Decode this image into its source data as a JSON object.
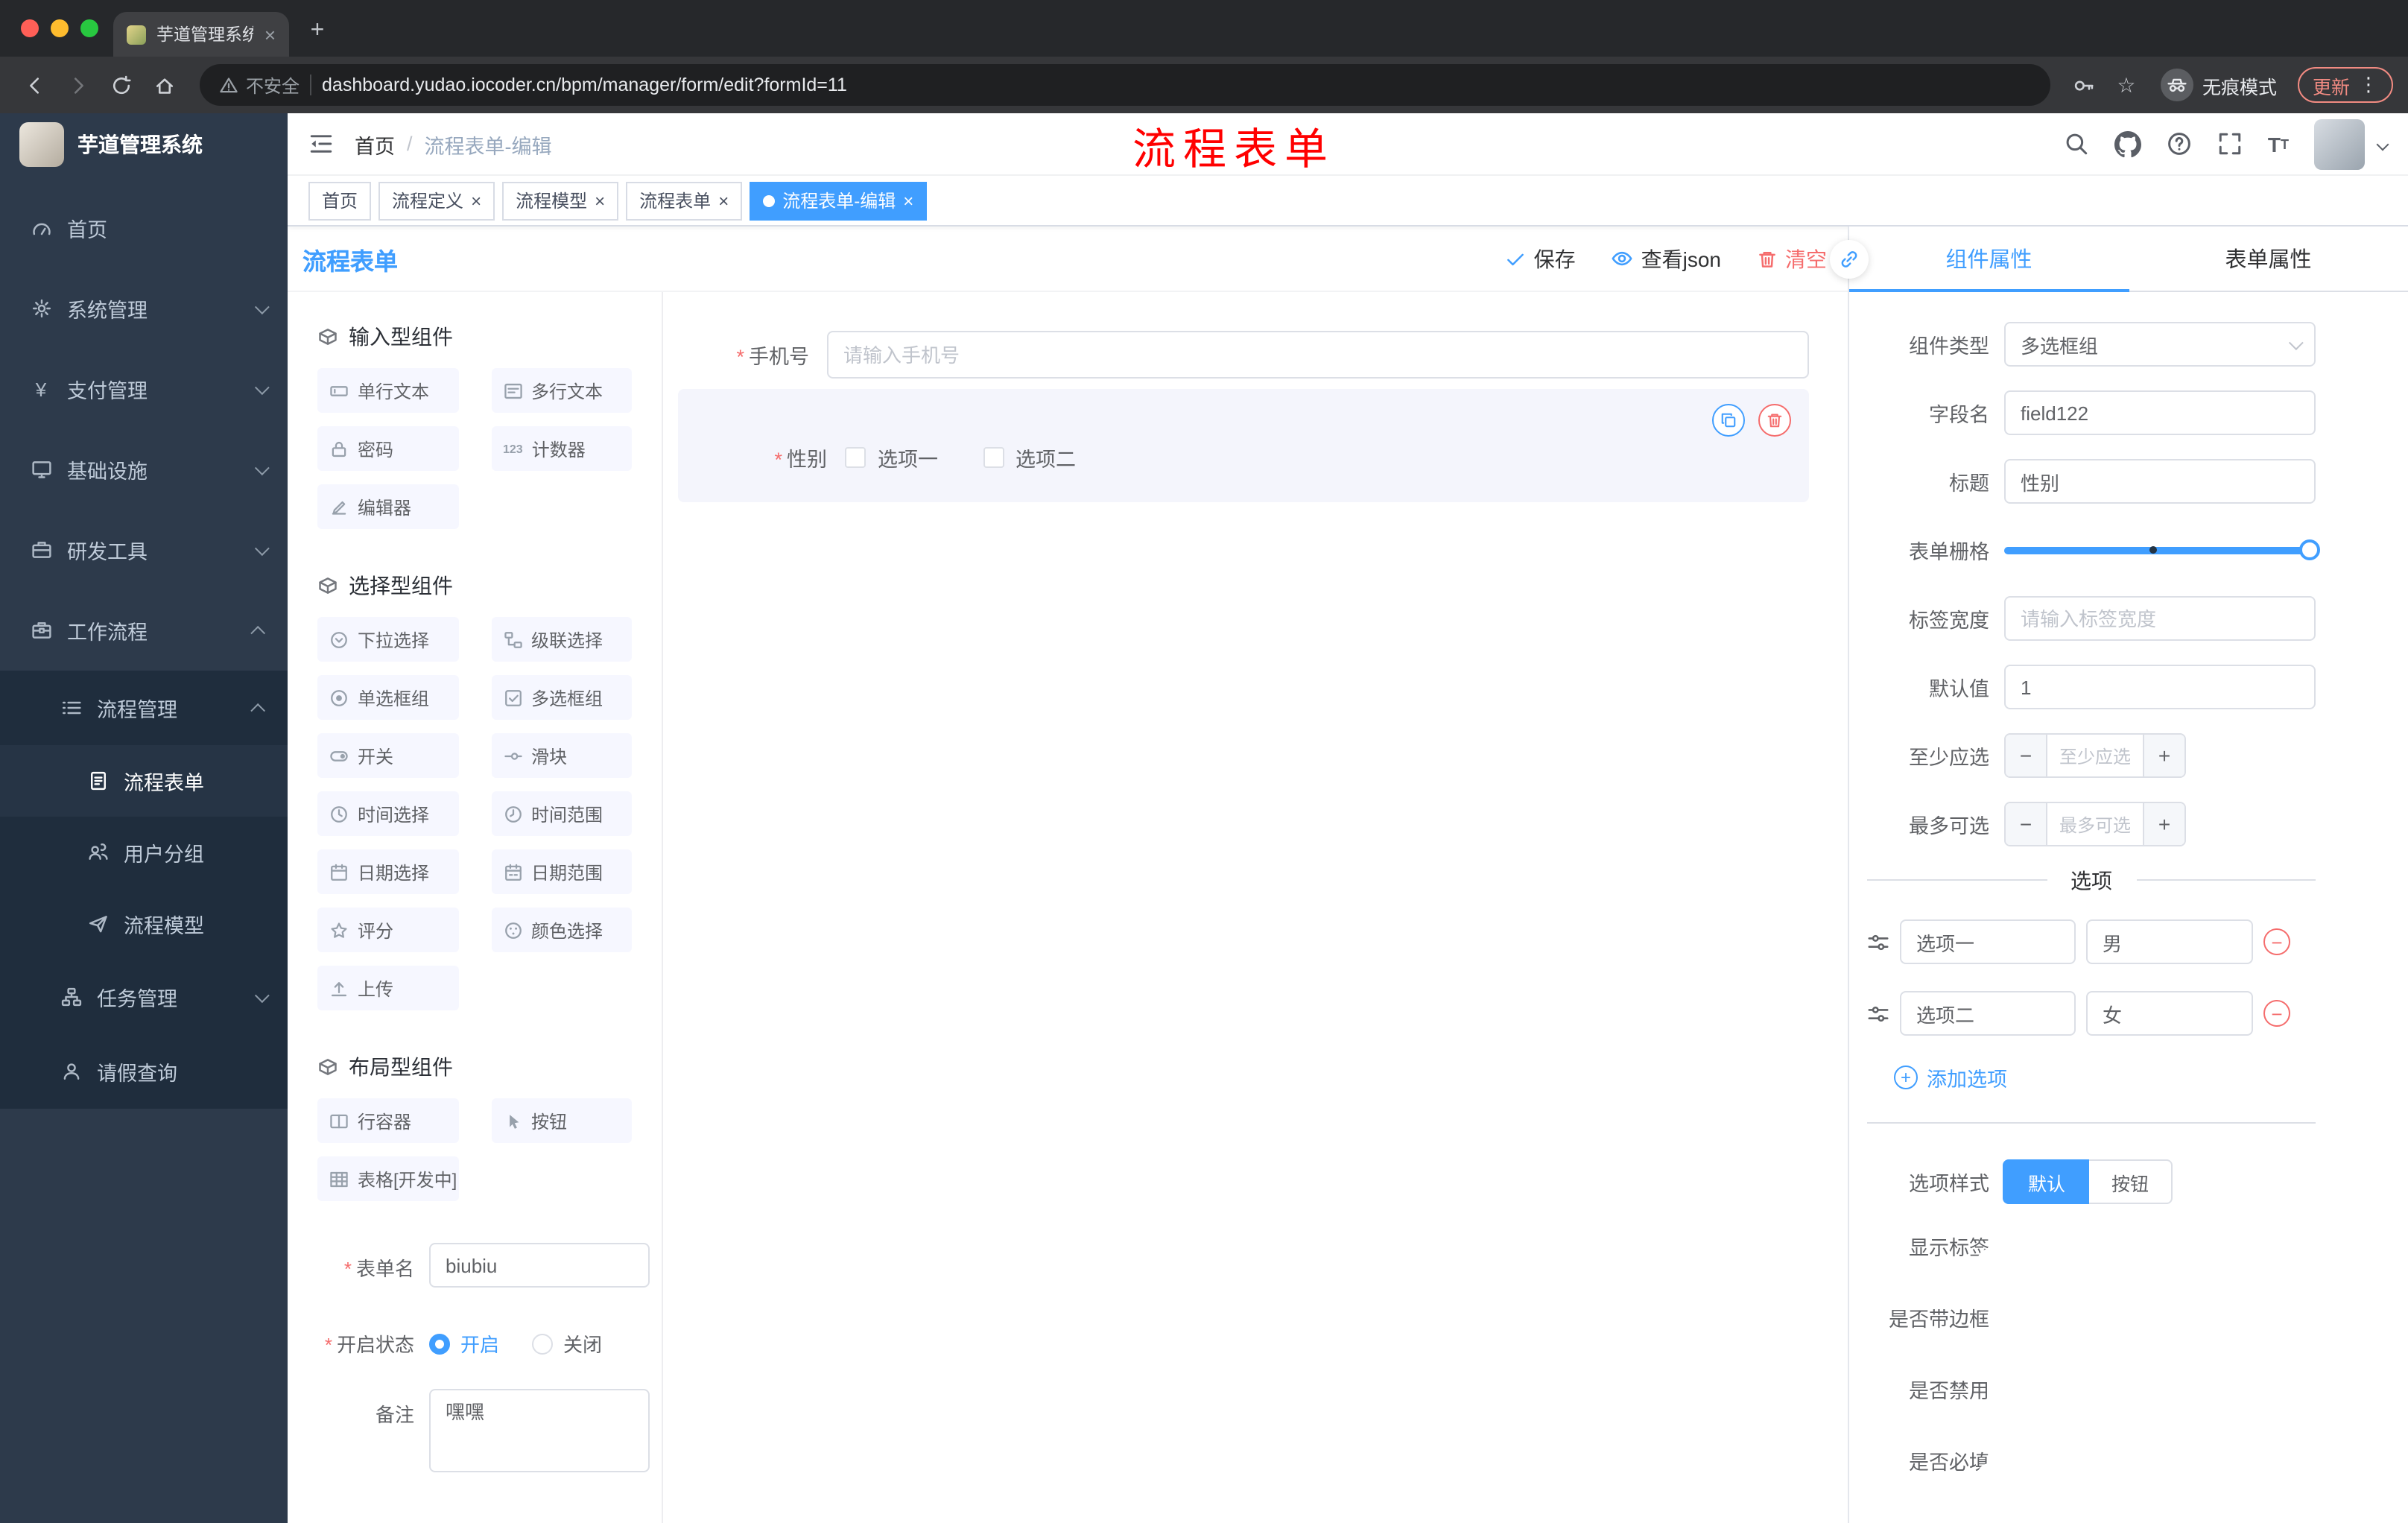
{
  "colors": {
    "primary": "#409eff",
    "danger": "#f56c6c",
    "annotation_red": "#ff0000",
    "sidebar_bg": "#2d3a4b",
    "sidebar_sub_bg": "#1f2d3d"
  },
  "browser": {
    "tab_title": "芋道管理系统",
    "new_tab": "+",
    "security_label": "不安全",
    "url": "dashboard.yudao.iocoder.cn/bpm/manager/form/edit?formId=11",
    "incognito_label": "无痕模式",
    "update_label": "更新",
    "menu_dots": "⋮",
    "star": "☆"
  },
  "sidebar": {
    "logo_title": "芋道管理系统",
    "items": [
      {
        "label": "首页",
        "icon": "dashboard-icon"
      },
      {
        "label": "系统管理",
        "icon": "gear-icon",
        "chevron": "down"
      },
      {
        "label": "支付管理",
        "icon": "payment-icon",
        "chevron": "down"
      },
      {
        "label": "基础设施",
        "icon": "infrastructure-icon",
        "chevron": "down"
      },
      {
        "label": "研发工具",
        "icon": "devtools-icon",
        "chevron": "down"
      },
      {
        "label": "工作流程",
        "icon": "workflow-icon",
        "chevron": "up"
      },
      {
        "label": "流程管理",
        "icon": "process-manage-icon",
        "chevron": "up"
      },
      {
        "label": "流程表单",
        "icon": "form-icon",
        "active": true
      },
      {
        "label": "用户分组",
        "icon": "user-group-icon"
      },
      {
        "label": "流程模型",
        "icon": "model-icon"
      },
      {
        "label": "任务管理",
        "icon": "task-icon",
        "chevron": "down"
      },
      {
        "label": "请假查询",
        "icon": "leave-icon"
      }
    ]
  },
  "header": {
    "breadcrumb_home": "首页",
    "breadcrumb_sep": "/",
    "breadcrumb_current": "流程表单-编辑",
    "annotation": "流程表单"
  },
  "tagbar": {
    "close_glyph": "×",
    "tags": [
      {
        "label": "首页"
      },
      {
        "label": "流程定义",
        "closable": true
      },
      {
        "label": "流程模型",
        "closable": true
      },
      {
        "label": "流程表单",
        "closable": true
      },
      {
        "label": "流程表单-编辑",
        "closable": true,
        "active": true
      }
    ]
  },
  "designer": {
    "title": "流程表单",
    "actions": {
      "save": "保存",
      "view_json": "查看json",
      "clear": "清空"
    },
    "groups": [
      {
        "title": "输入型组件",
        "items": [
          {
            "label": "单行文本"
          },
          {
            "label": "多行文本"
          },
          {
            "label": "密码"
          },
          {
            "label": "计数器"
          },
          {
            "label": "编辑器"
          }
        ]
      },
      {
        "title": "选择型组件",
        "items": [
          {
            "label": "下拉选择"
          },
          {
            "label": "级联选择"
          },
          {
            "label": "单选框组"
          },
          {
            "label": "多选框组"
          },
          {
            "label": "开关"
          },
          {
            "label": "滑块"
          },
          {
            "label": "时间选择"
          },
          {
            "label": "时间范围"
          },
          {
            "label": "日期选择"
          },
          {
            "label": "日期范围"
          },
          {
            "label": "评分"
          },
          {
            "label": "颜色选择"
          },
          {
            "label": "上传"
          }
        ]
      },
      {
        "title": "布局型组件",
        "items": [
          {
            "label": "行容器"
          },
          {
            "label": "按钮"
          },
          {
            "label": "表格[开发中]"
          }
        ]
      }
    ],
    "form_config": {
      "name_label": "表单名",
      "name_value": "biubiu",
      "status_label": "开启状态",
      "status_on": "开启",
      "status_off": "关闭",
      "remark_label": "备注",
      "remark_value": "嘿嘿"
    },
    "canvas": {
      "phone": {
        "label": "手机号",
        "placeholder": "请输入手机号",
        "required": true
      },
      "gender": {
        "label": "性别",
        "required": true,
        "options": [
          "选项一",
          "选项二"
        ]
      }
    }
  },
  "props": {
    "tabs": {
      "component": "组件属性",
      "form": "表单属性"
    },
    "component_type": {
      "label": "组件类型",
      "value": "多选框组"
    },
    "field_name": {
      "label": "字段名",
      "value": "field122"
    },
    "title": {
      "label": "标题",
      "value": "性别"
    },
    "grid": {
      "label": "表单栅格"
    },
    "label_width": {
      "label": "标签宽度",
      "placeholder": "请输入标签宽度"
    },
    "default_value": {
      "label": "默认值",
      "value": "1"
    },
    "min_select": {
      "label": "至少应选",
      "placeholder": "至少应选",
      "minus": "−",
      "plus": "+"
    },
    "max_select": {
      "label": "最多可选",
      "placeholder": "最多可选",
      "minus": "−",
      "plus": "+"
    },
    "options_title": "选项",
    "options": [
      {
        "label": "选项一",
        "value": "男"
      },
      {
        "label": "选项二",
        "value": "女"
      }
    ],
    "add_option": "添加选项",
    "option_style": {
      "label": "选项样式",
      "default": "默认",
      "button": "按钮"
    },
    "switches": [
      {
        "label": "显示标签",
        "on": true
      },
      {
        "label": "是否带边框",
        "on": false
      },
      {
        "label": "是否禁用",
        "on": false
      },
      {
        "label": "是否必填",
        "on": true
      }
    ]
  }
}
